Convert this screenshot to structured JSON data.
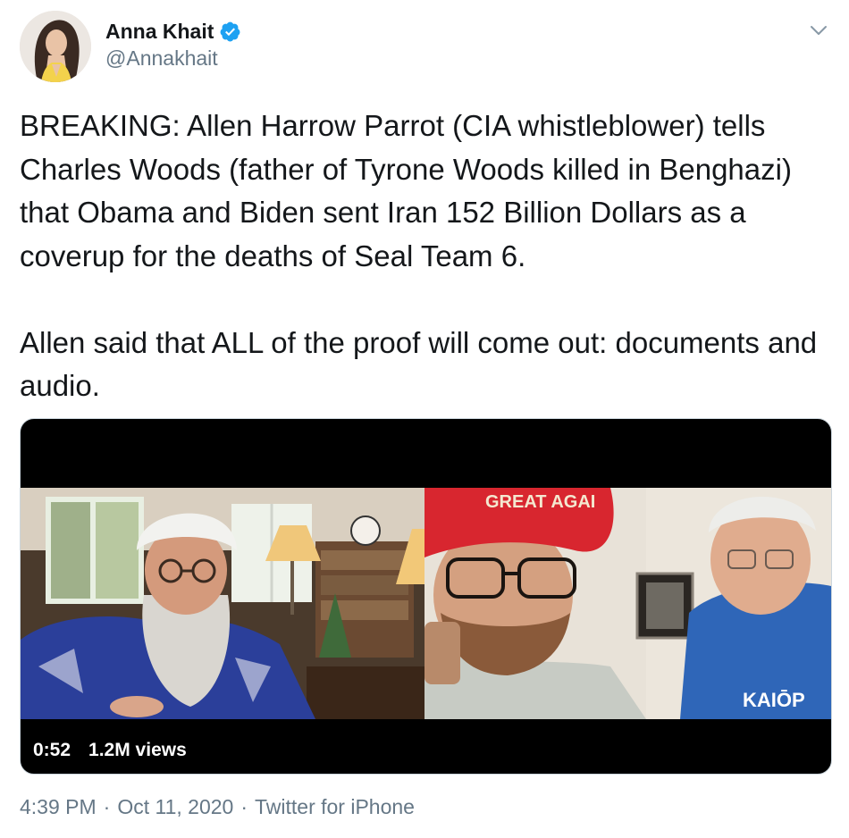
{
  "author": {
    "display_name": "Anna Khait",
    "handle": "@Annakhait",
    "verified": true,
    "avatar_icon": "profile-photo"
  },
  "tweet": {
    "text": "BREAKING: Allen Harrow Parrot (CIA whistleblower) tells Charles Woods (father of Tyrone Woods killed in Benghazi) that Obama and Biden sent Iran 152 Billion Dollars as a coverup for the deaths of Seal Team 6.\n\nAllen said that ALL of the proof will come out: documents and audio."
  },
  "media": {
    "duration": "0:52",
    "views": "1.2M views",
    "overlay_hat_text": "GREAT AGAI",
    "overlay_shirt_text": "KAIŌP"
  },
  "footer": {
    "time": "4:39 PM",
    "separator": "·",
    "date": "Oct 11, 2020",
    "source": "Twitter for iPhone"
  },
  "colors": {
    "text_primary": "#14171a",
    "text_secondary": "#657786",
    "verified_blue": "#1da1f2",
    "media_border": "#ccd6dd"
  }
}
